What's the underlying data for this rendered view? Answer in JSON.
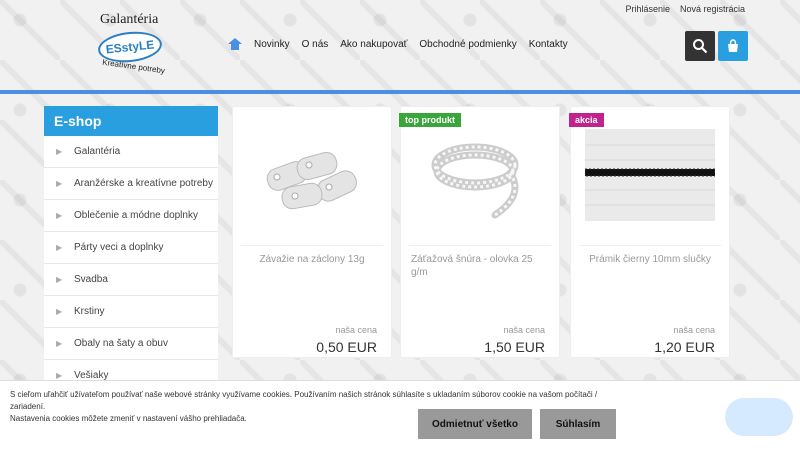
{
  "header": {
    "logo": {
      "top": "Galantéria",
      "badge": "ESstyLE",
      "bottom": "Kreatívne potreby"
    },
    "top_links": [
      "Prihlásenie",
      "Nová registrácia"
    ],
    "nav": [
      "Novinky",
      "O nás",
      "Ako nakupovať",
      "Obchodné podmienky",
      "Kontakty"
    ]
  },
  "sidebar": {
    "title": "E-shop",
    "items": [
      "Galantéria",
      "Aranžérske a kreatívne potreby",
      "Oblečenie a módne doplnky",
      "Párty veci a doplnky",
      "Svadba",
      "Krstiny",
      "Obaly na šaty a obuv",
      "Vešiaky"
    ]
  },
  "products": [
    {
      "badge": "",
      "name": "Závažie na záclony 13g",
      "price_label": "naša cena",
      "price": "0,50 EUR"
    },
    {
      "badge": "top produkt",
      "name": "Záťažová šnúra - olovka 25 g/m",
      "price_label": "naša cena",
      "price": "1,50 EUR"
    },
    {
      "badge": "akcia",
      "name": "Prámik čierny 10mm slučky",
      "price_label": "naša cena",
      "price": "1,20 EUR"
    }
  ],
  "cookie": {
    "text_line1": "S cieľom uľahčiť užívateľom používať naše webové stránky využívame cookies. Používaním našich stránok súhlasíte s ukladaním súborov cookie na vašom počítači / zariadení.",
    "text_line2": "Nastavenia cookies môžete zmeniť v nastavení vášho prehliadača.",
    "reject": "Odmietnuť všetko",
    "accept": "Súhlasím"
  },
  "colors": {
    "accent": "#2a9fe0",
    "top_produkt": "#3aa53a",
    "akcia": "#c0238d"
  },
  "icons": [
    "home-icon",
    "search-icon",
    "cart-icon",
    "arrow-right-icon",
    "chat-icon"
  ]
}
